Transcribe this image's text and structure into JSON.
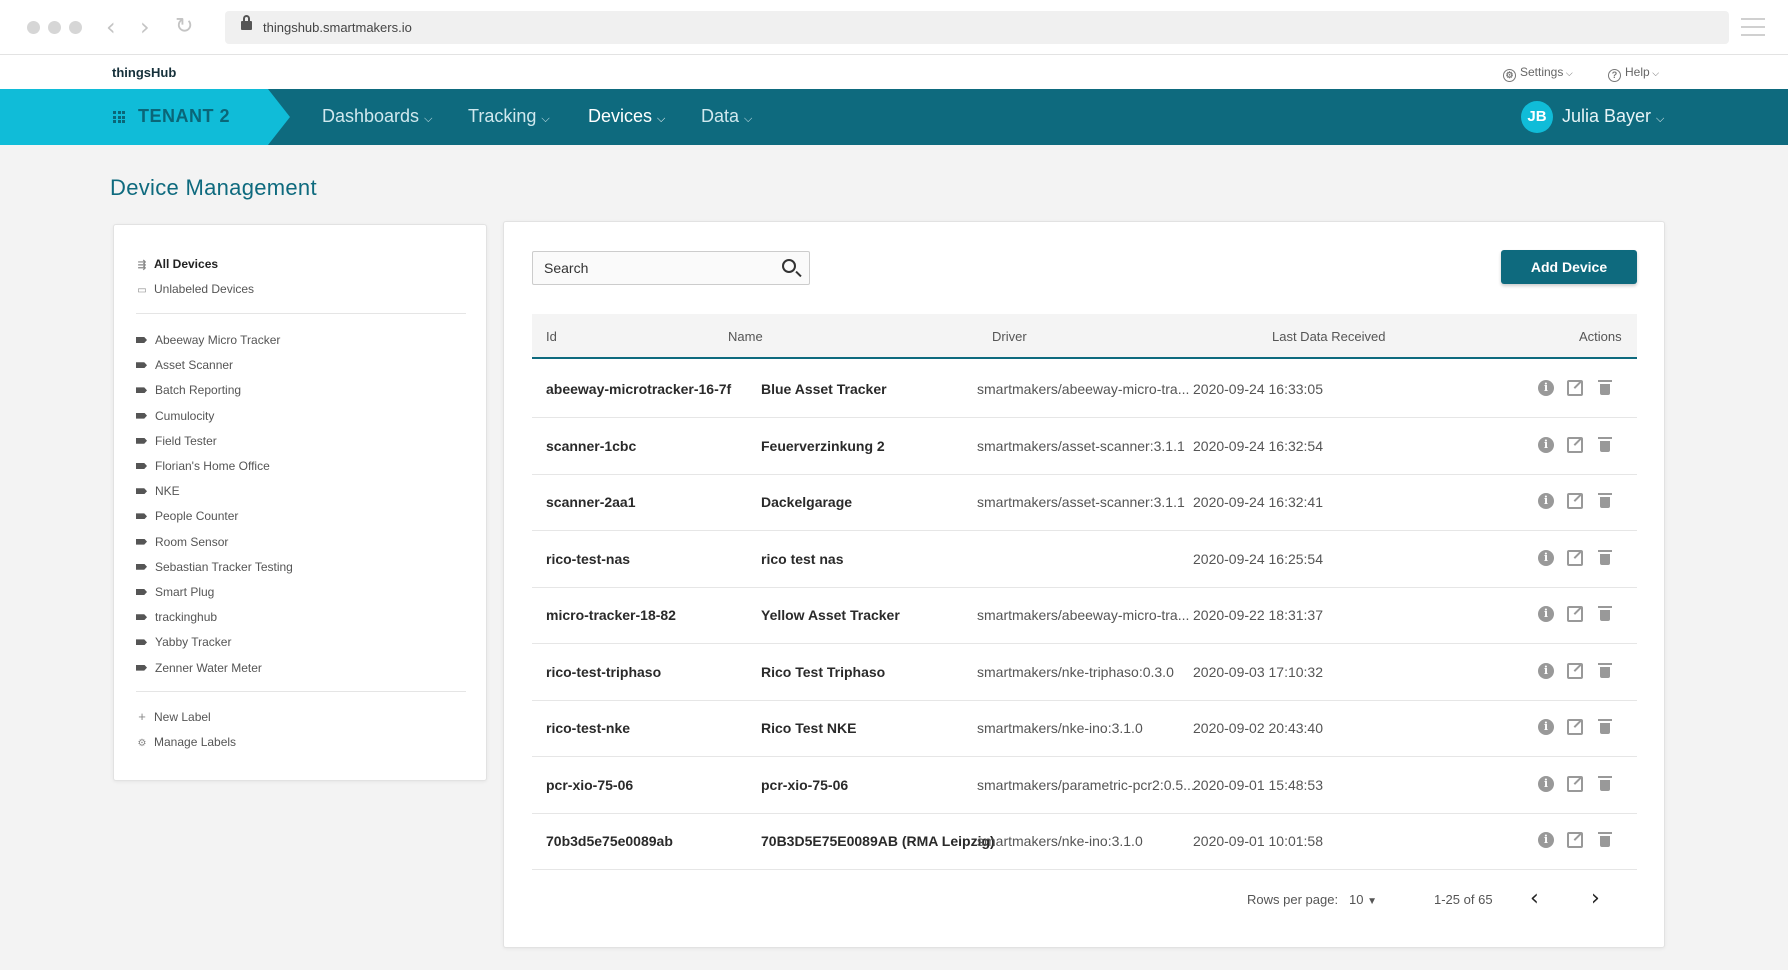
{
  "browser": {
    "url": "thingshub.smartmakers.io"
  },
  "topbar": {
    "brand": "thingsHub",
    "settings": "Settings",
    "help": "Help"
  },
  "nav": {
    "tenant": "TENANT 2",
    "items": [
      "Dashboards",
      "Tracking",
      "Devices",
      "Data"
    ],
    "active": "Devices",
    "user_initials": "JB",
    "user_name": "Julia Bayer"
  },
  "page": {
    "title": "Device Management"
  },
  "sidebar": {
    "all_devices": "All Devices",
    "unlabeled": "Unlabeled Devices",
    "labels": [
      "Abeeway Micro Tracker",
      "Asset Scanner",
      "Batch Reporting",
      "Cumulocity",
      "Field Tester",
      "Florian's Home Office",
      "NKE",
      "People Counter",
      "Room Sensor",
      "Sebastian Tracker Testing",
      "Smart Plug",
      "trackinghub",
      "Yabby Tracker",
      "Zenner Water Meter"
    ],
    "new_label": "New Label",
    "manage_labels": "Manage Labels"
  },
  "toolbar": {
    "search_placeholder": "Search",
    "add_device": "Add Device"
  },
  "table": {
    "columns": [
      "Id",
      "Name",
      "Driver",
      "Last Data Received",
      "Actions"
    ],
    "rows": [
      {
        "id": "abeeway-microtracker-16-7f",
        "name": "Blue Asset Tracker",
        "driver": "smartmakers/abeeway-micro-tra...",
        "last": "2020-09-24 16:33:05"
      },
      {
        "id": "scanner-1cbc",
        "name": "Feuerverzinkung 2",
        "driver": "smartmakers/asset-scanner:3.1.1",
        "last": "2020-09-24 16:32:54"
      },
      {
        "id": "scanner-2aa1",
        "name": "Dackelgarage",
        "driver": "smartmakers/asset-scanner:3.1.1",
        "last": "2020-09-24 16:32:41"
      },
      {
        "id": "rico-test-nas",
        "name": "rico test nas",
        "driver": "",
        "last": "2020-09-24 16:25:54"
      },
      {
        "id": "micro-tracker-18-82",
        "name": "Yellow Asset Tracker",
        "driver": "smartmakers/abeeway-micro-tra...",
        "last": "2020-09-22 18:31:37"
      },
      {
        "id": "rico-test-triphaso",
        "name": "Rico Test Triphaso",
        "driver": "smartmakers/nke-triphaso:0.3.0",
        "last": "2020-09-03 17:10:32"
      },
      {
        "id": "rico-test-nke",
        "name": "Rico Test NKE",
        "driver": "smartmakers/nke-ino:3.1.0",
        "last": "2020-09-02 20:43:40"
      },
      {
        "id": "pcr-xio-75-06",
        "name": "pcr-xio-75-06",
        "driver": "smartmakers/parametric-pcr2:0.5...",
        "last": "2020-09-01 15:48:53"
      },
      {
        "id": "70b3d5e75e0089ab",
        "name": "70B3D5E75E0089AB (RMA Leipzig)",
        "driver": "smartmakers/nke-ino:3.1.0",
        "last": "2020-09-01 10:01:58"
      }
    ]
  },
  "pagination": {
    "rows_label": "Rows per page:",
    "rows_value": "10",
    "range": "1-25 of 65"
  }
}
